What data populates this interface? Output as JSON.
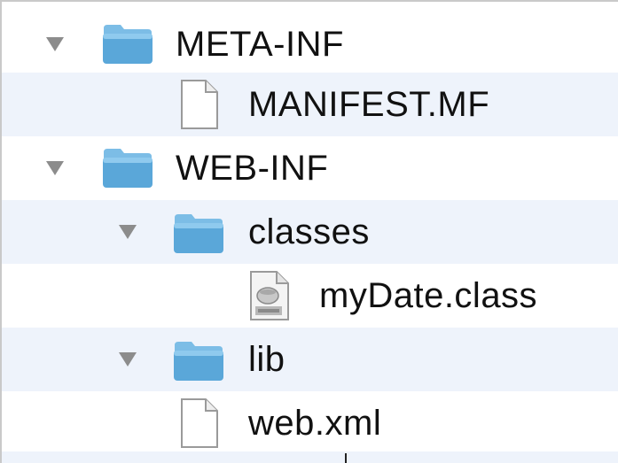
{
  "tree": {
    "items": [
      {
        "label": "META-INF",
        "kind": "folder",
        "expanded": true,
        "icon": "folder-icon"
      },
      {
        "label": "MANIFEST.MF",
        "kind": "file",
        "icon": "document-icon"
      },
      {
        "label": "WEB-INF",
        "kind": "folder",
        "expanded": true,
        "icon": "folder-icon"
      },
      {
        "label": "classes",
        "kind": "folder",
        "expanded": true,
        "icon": "folder-icon"
      },
      {
        "label": "myDate.class",
        "kind": "file",
        "icon": "java-class-icon"
      },
      {
        "label": "lib",
        "kind": "folder",
        "expanded": true,
        "icon": "folder-icon"
      },
      {
        "label": "web.xml",
        "kind": "file",
        "icon": "document-icon"
      }
    ]
  },
  "colors": {
    "alternate_row": "#eef3fb",
    "folder_blue": "#58a8d8",
    "disclosure_gray": "#8c8c8c"
  }
}
